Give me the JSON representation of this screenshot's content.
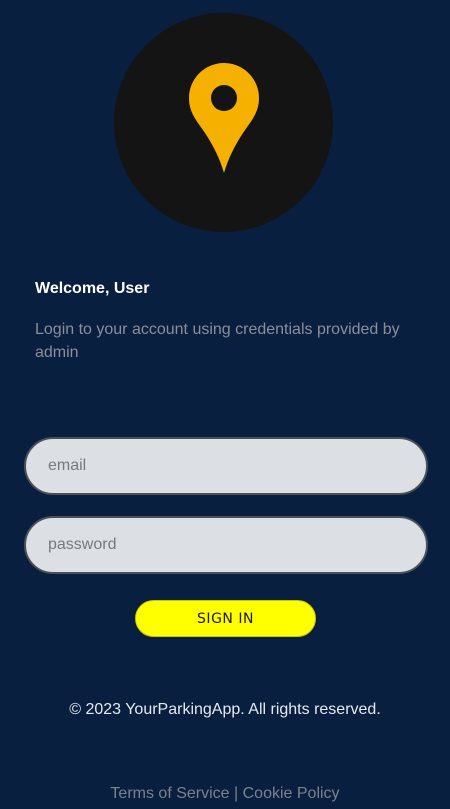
{
  "logo": {
    "icon": "map-pin-icon",
    "circle_color": "#141414",
    "pin_color": "#f5b000"
  },
  "header": {
    "welcome": "Welcome, User",
    "subtitle": "Login to your account using credentials provided by admin"
  },
  "form": {
    "email_placeholder": "email",
    "password_placeholder": "password",
    "signin_label": "SIGN IN"
  },
  "footer": {
    "copyright": "© 2023 YourParkingApp. All rights reserved.",
    "terms_label": "Terms of Service",
    "separator": "|",
    "cookie_label": "Cookie Policy"
  },
  "colors": {
    "background": "#081f3f",
    "accent_button": "#ffff00"
  }
}
